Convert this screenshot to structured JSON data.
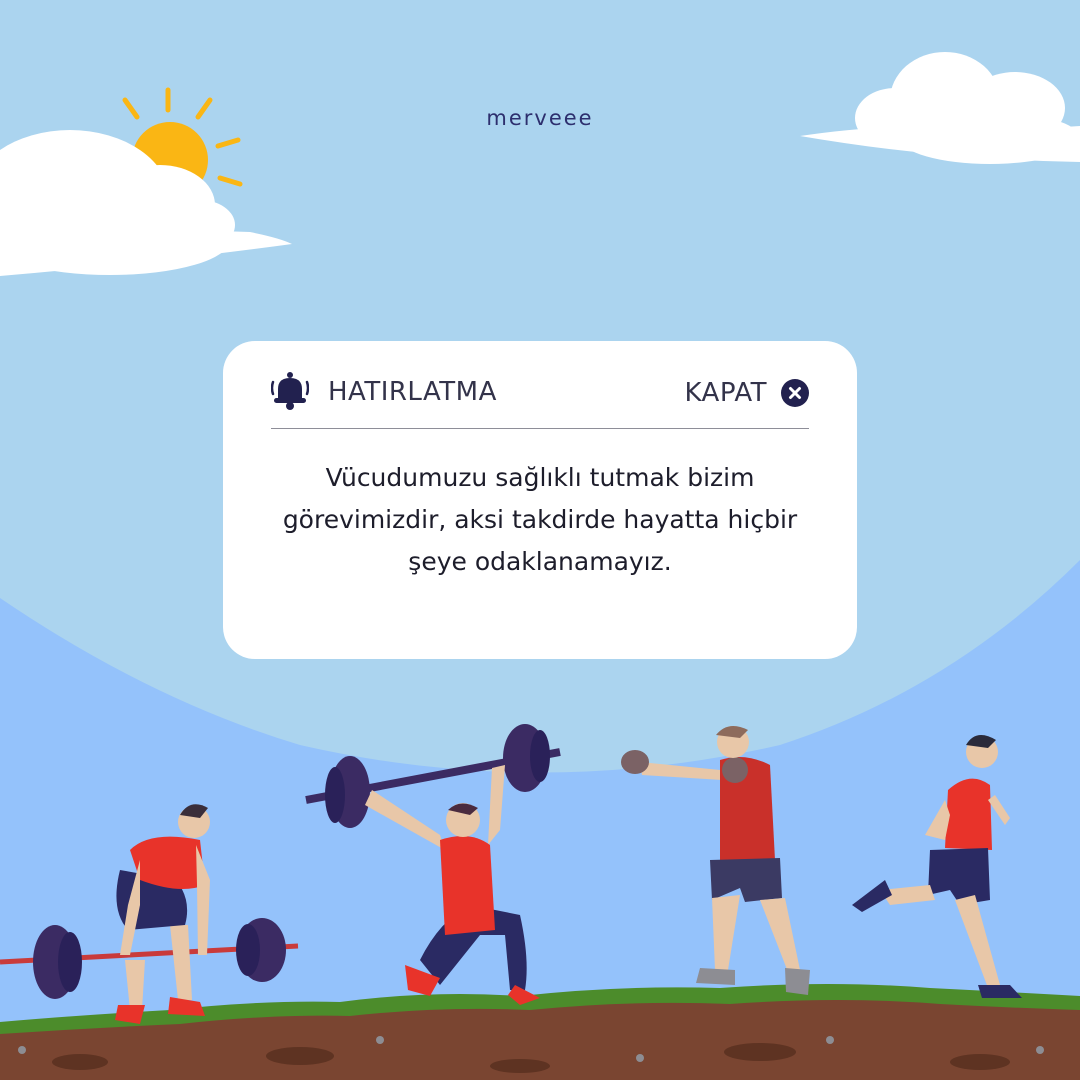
{
  "brand": {
    "name": "merveee"
  },
  "reminder": {
    "title": "HATIRLATMA",
    "close_label": "KAPAT",
    "message": "Vücudumuzu sağlıklı tutmak bizim görevimizdir, aksi takdirde hayatta hiçbir şeye odaklanamayız."
  },
  "colors": {
    "sky": "#abd4ef",
    "lower_sky": "#94c2fb",
    "sun": "#fab614",
    "brand_text": "#2d2f6e",
    "icon_dark": "#22214f",
    "card": "#ffffff",
    "grass": "#4c8c2b",
    "soil": "#7a4531",
    "shirt_red": "#e8332a",
    "shorts_navy": "#2a2a63"
  },
  "icons": {
    "reminder": "bell-icon",
    "close": "close-circle-icon"
  },
  "illustration": {
    "scene": "sky-sun-clouds-hill",
    "athletes": [
      "deadlift-athlete",
      "overhead-lunge-athlete",
      "boxer-athlete",
      "runner-athlete"
    ]
  }
}
